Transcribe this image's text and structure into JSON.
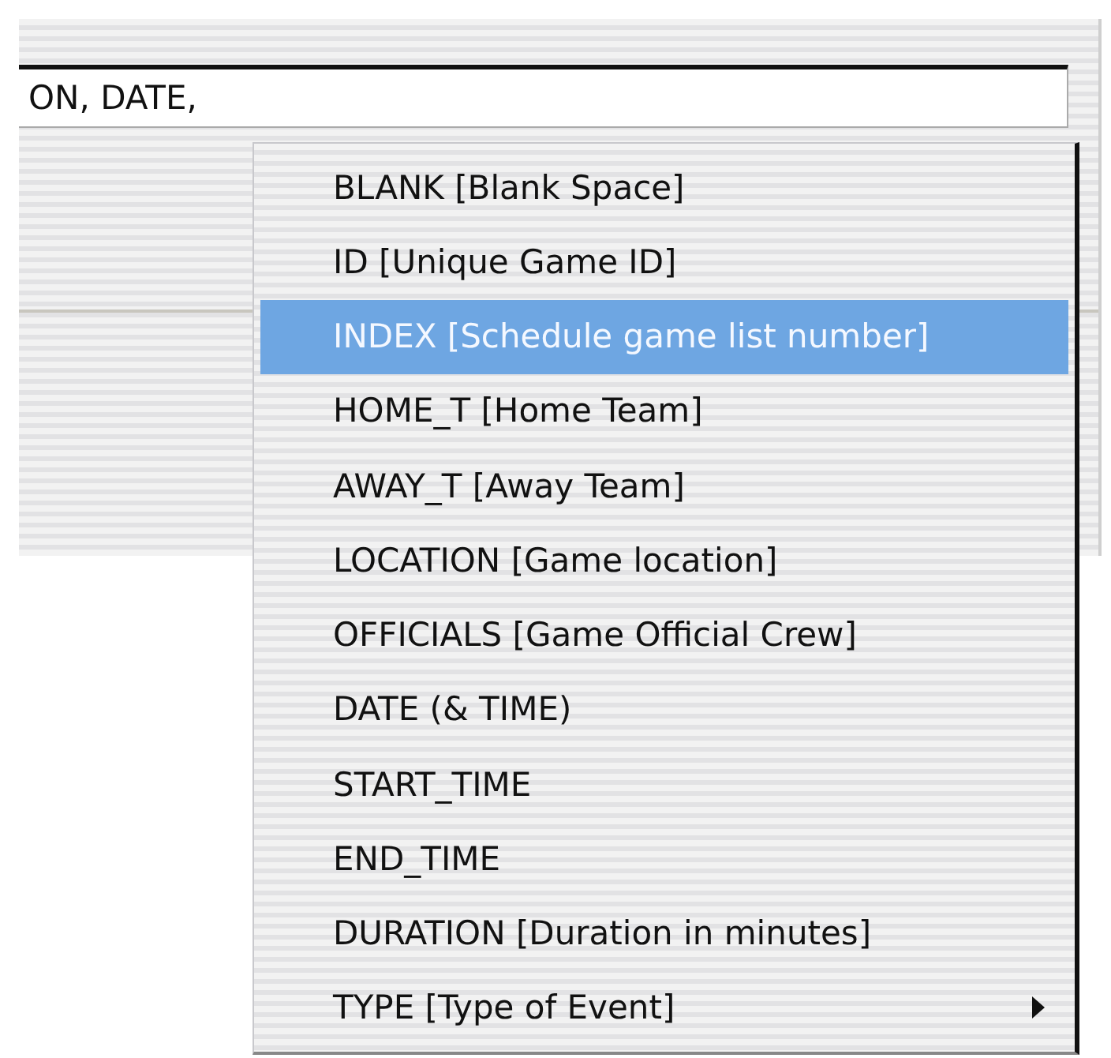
{
  "field": {
    "value": "ON, DATE,"
  },
  "menu": {
    "items": [
      {
        "label": "BLANK [Blank Space]",
        "selected": false,
        "submenu": false
      },
      {
        "label": "ID [Unique Game ID]",
        "selected": false,
        "submenu": false
      },
      {
        "label": "INDEX [Schedule game list number]",
        "selected": true,
        "submenu": false
      },
      {
        "label": "HOME_T [Home Team]",
        "selected": false,
        "submenu": false
      },
      {
        "label": "AWAY_T [Away Team]",
        "selected": false,
        "submenu": false
      },
      {
        "label": "LOCATION [Game location]",
        "selected": false,
        "submenu": false
      },
      {
        "label": "OFFICIALS [Game Official Crew]",
        "selected": false,
        "submenu": false
      },
      {
        "label": "DATE (& TIME)",
        "selected": false,
        "submenu": false
      },
      {
        "label": "START_TIME",
        "selected": false,
        "submenu": false
      },
      {
        "label": "END_TIME",
        "selected": false,
        "submenu": false
      },
      {
        "label": "DURATION [Duration in minutes]",
        "selected": false,
        "submenu": false
      },
      {
        "label": "TYPE [Type of Event]",
        "selected": false,
        "submenu": true
      }
    ]
  }
}
